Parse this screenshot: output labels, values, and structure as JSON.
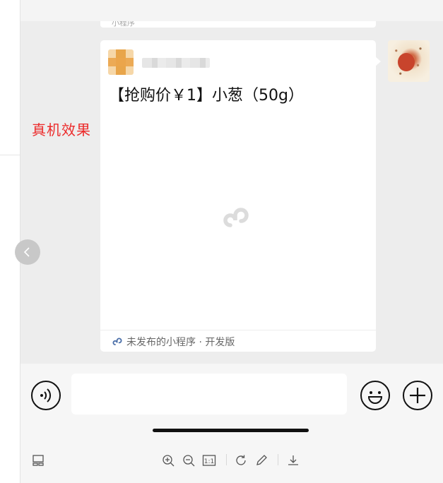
{
  "annotation": {
    "label": "真机效果",
    "color": "#ec2b2b"
  },
  "previous_message": {
    "snippet": "小程序"
  },
  "mini_program_card": {
    "title": "【抢购价￥1】小葱（50g）",
    "footer_text": "未发布的小程序 · 开发版"
  },
  "input": {
    "value": "",
    "placeholder": ""
  },
  "icons": {
    "nav": "chevron-left-icon",
    "voice": "voice-icon",
    "emoji": "emoji-icon",
    "plus": "plus-icon",
    "toolbar": [
      "layout-icon",
      "zoom-in-icon",
      "zoom-out-icon",
      "actual-size-icon",
      "rotate-icon",
      "edit-icon",
      "download-icon"
    ]
  },
  "toolbar": {
    "actual_size_label": "1:1"
  },
  "colors": {
    "chat_bg": "#ededed",
    "card_bg": "#ffffff",
    "mini_program_blue": "#4a6ea8"
  }
}
